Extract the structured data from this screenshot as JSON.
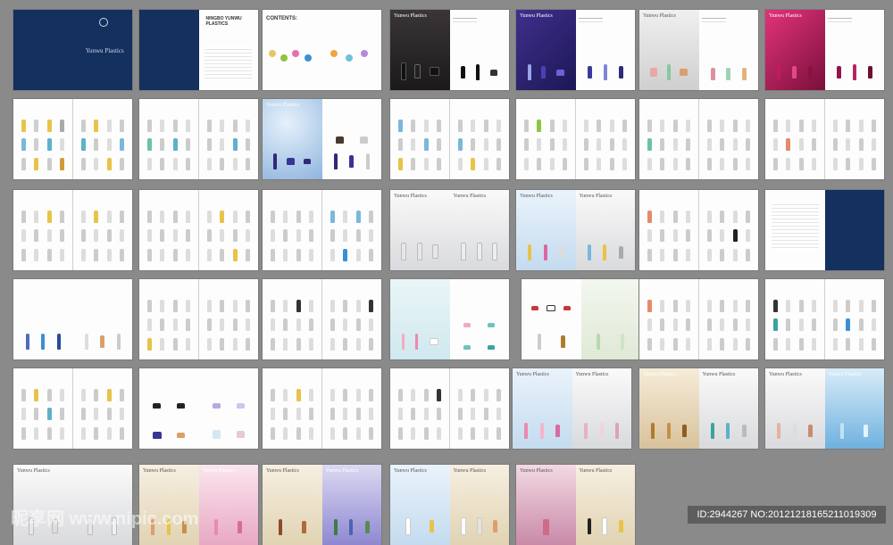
{
  "brand": "Yunwu Plastics",
  "cover_brand": "Yunwu Plastics",
  "contents_title": "CONTENTS:",
  "intro_title": "NINGBO YUNWU PLASTICS",
  "watermark": "昵享网 www.nipic.com",
  "image_id": "ID:2944267 NO:20121218165211019309",
  "colors": {
    "background": "#8a8a8a",
    "navy": "#14305e",
    "accent_green": "#8dc63f",
    "accent_blue": "#3b8fd3"
  }
}
